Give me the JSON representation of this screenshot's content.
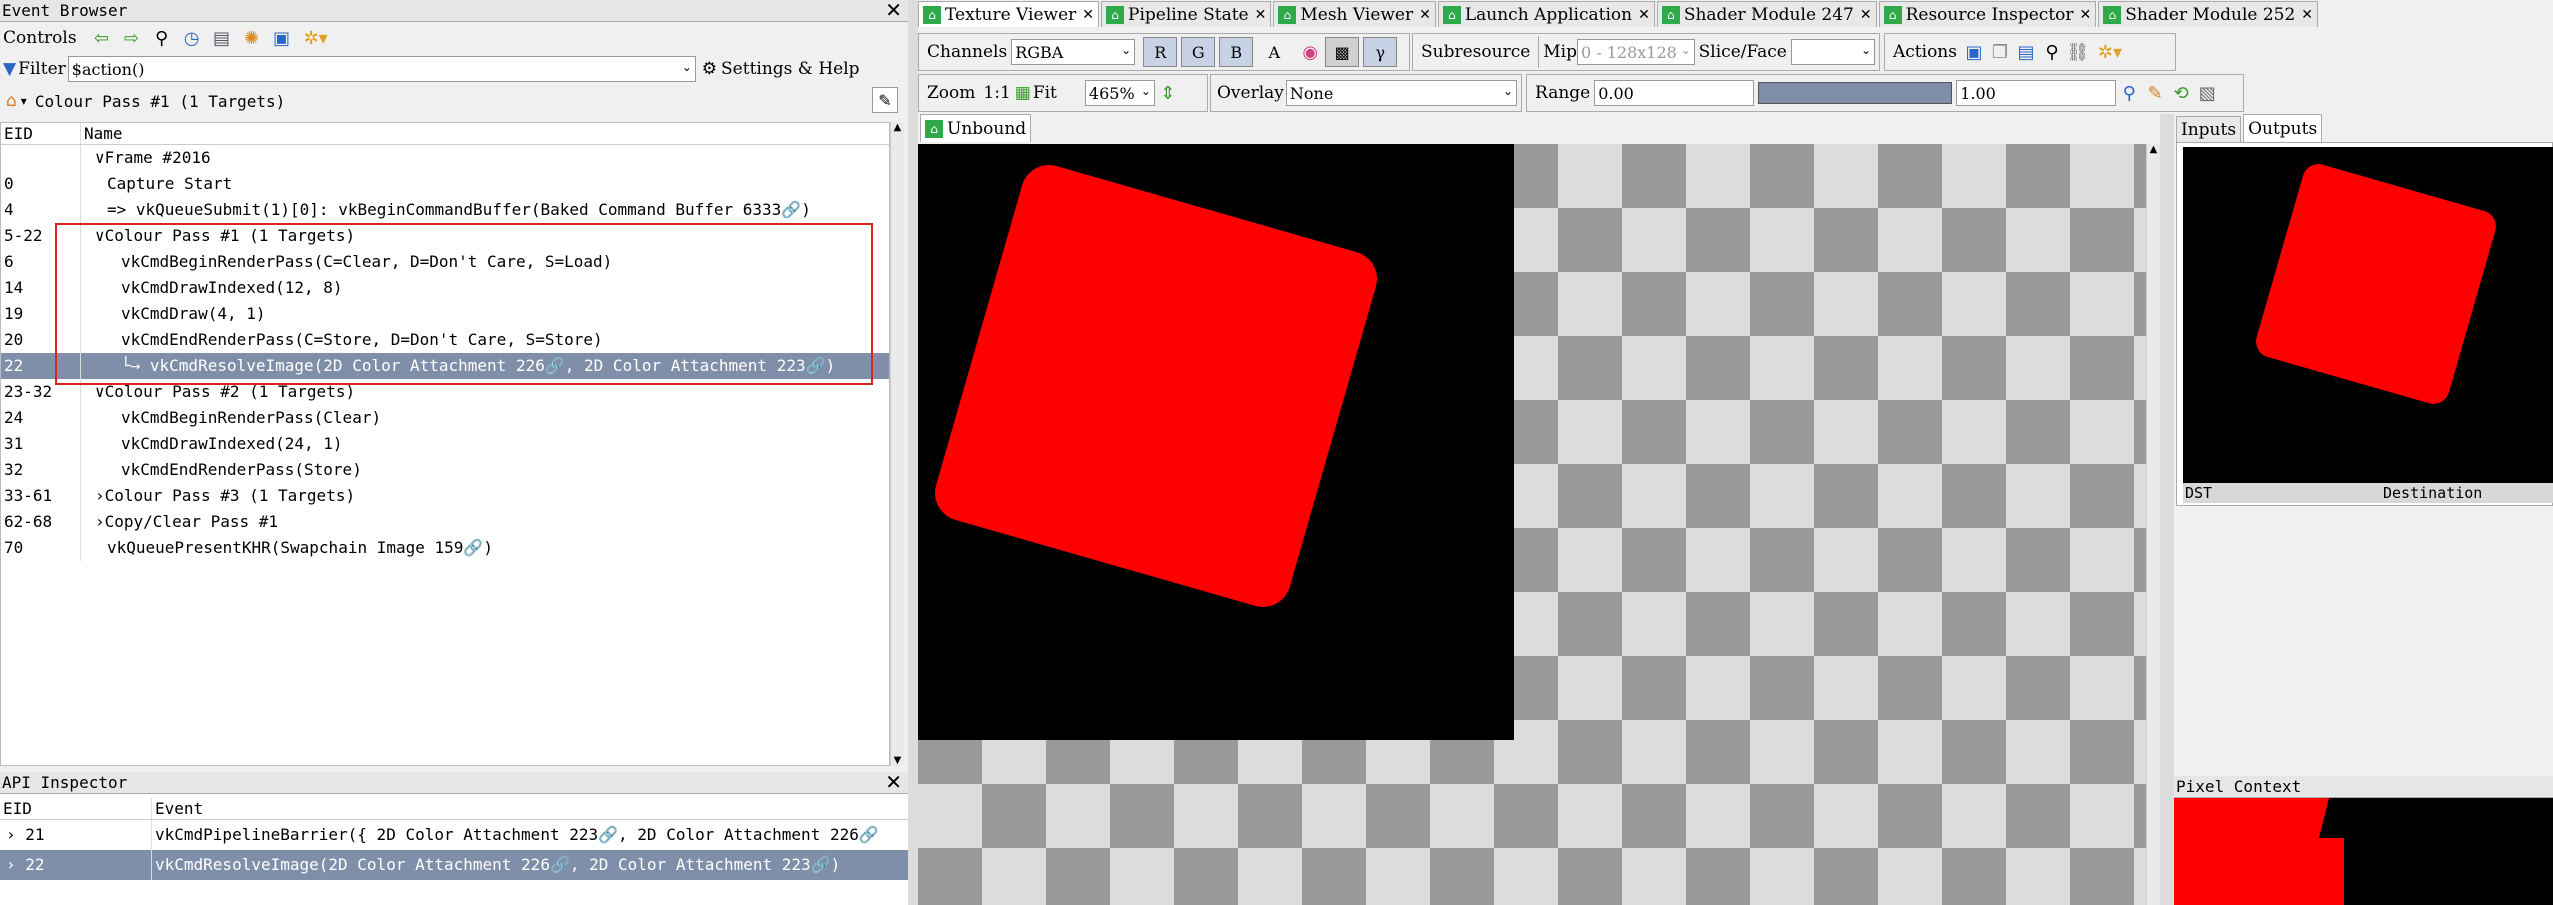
{
  "event_browser": {
    "title": "Event Browser",
    "controls_label": "Controls",
    "filter_label": "Filter",
    "filter_value": "$action()",
    "settings_label": "Settings & Help",
    "breadcrumb": "Colour Pass #1 (1 Targets)",
    "col_eid": "EID",
    "col_name": "Name",
    "rows": [
      {
        "eid": "",
        "name": "∨Frame #2016"
      },
      {
        "eid": "0",
        "name": "Capture Start"
      },
      {
        "eid": "4",
        "name": "=> vkQueueSubmit(1)[0]: vkBeginCommandBuffer(Baked Command Buffer 6333🔗)"
      },
      {
        "eid": "5-22",
        "name": "∨Colour Pass #1 (1 Targets)"
      },
      {
        "eid": "6",
        "name": "vkCmdBeginRenderPass(C=Clear, D=Don't Care, S=Load)"
      },
      {
        "eid": "14",
        "name": "vkCmdDrawIndexed(12, 8)"
      },
      {
        "eid": "19",
        "name": "vkCmdDraw(4, 1)"
      },
      {
        "eid": "20",
        "name": "vkCmdEndRenderPass(C=Store, D=Don't Care, S=Store)"
      },
      {
        "eid": "22",
        "name": "└→ vkCmdResolveImage(2D Color Attachment 226🔗, 2D Color Attachment 223🔗)"
      },
      {
        "eid": "23-32",
        "name": "∨Colour Pass #2 (1 Targets)"
      },
      {
        "eid": "24",
        "name": "vkCmdBeginRenderPass(Clear)"
      },
      {
        "eid": "31",
        "name": "vkCmdDrawIndexed(24, 1)"
      },
      {
        "eid": "32",
        "name": "vkCmdEndRenderPass(Store)"
      },
      {
        "eid": "33-61",
        "name": "›Colour Pass #3 (1 Targets)"
      },
      {
        "eid": "62-68",
        "name": "›Copy/Clear Pass #1"
      },
      {
        "eid": "70",
        "name": "vkQueuePresentKHR(Swapchain Image 159🔗)"
      }
    ]
  },
  "api_inspector": {
    "title": "API Inspector",
    "col_eid": "EID",
    "col_event": "Event",
    "rows": [
      {
        "eid": "21",
        "event": "vkCmdPipelineBarrier({ 2D Color Attachment 223🔗, 2D Color Attachment 226🔗"
      },
      {
        "eid": "22",
        "event": "vkCmdResolveImage(2D Color Attachment 226🔗, 2D Color Attachment 223🔗)"
      }
    ]
  },
  "tabs": [
    {
      "label": "Texture Viewer"
    },
    {
      "label": "Pipeline State"
    },
    {
      "label": "Mesh Viewer"
    },
    {
      "label": "Launch Application"
    },
    {
      "label": "Shader Module 247"
    },
    {
      "label": "Resource Inspector"
    },
    {
      "label": "Shader Module 252"
    }
  ],
  "texture_viewer": {
    "channels_label": "Channels",
    "channels_value": "RGBA",
    "ch_r": "R",
    "ch_g": "G",
    "ch_b": "B",
    "ch_a": "A",
    "gamma": "γ",
    "subresource_label": "Subresource",
    "mip_label": "Mip",
    "mip_value": "0 - 128x128",
    "slice_label": "Slice/Face",
    "actions_label": "Actions",
    "zoom_label": "Zoom",
    "zoom_11": "1:1",
    "fit_label": "Fit",
    "zoom_value": "465%",
    "overlay_label": "Overlay",
    "overlay_value": "None",
    "range_label": "Range",
    "range_min": "0.00",
    "range_max": "1.00",
    "unbound_tab": "Unbound"
  },
  "right_panel": {
    "inputs_tab": "Inputs",
    "outputs_tab": "Outputs",
    "dst_label": "DST",
    "dest_label": "Destination",
    "pixel_context": "Pixel Context"
  },
  "colors": {
    "red": "#ff0000",
    "selection": "#7f8fa9",
    "highlight_box": "#e02020",
    "tab_icon": "#2eaa4a"
  }
}
